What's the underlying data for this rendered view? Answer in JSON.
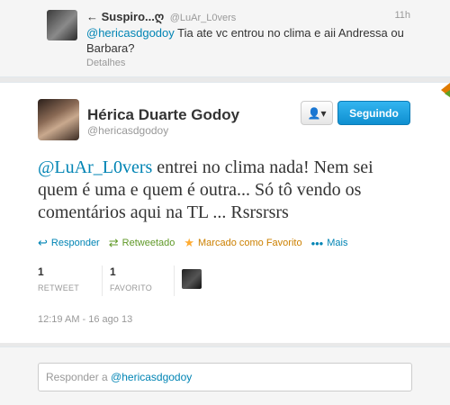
{
  "parent_tweet": {
    "back_arrow": "←",
    "name": "Suspiro...ღ",
    "handle": "@LuAr_L0vers",
    "time": "11h",
    "mention": "@hericasdgodoy",
    "text": " Tia ate vc entrou no clima e aii Andressa ou Barbara?",
    "details_label": "Detalhes"
  },
  "tweet": {
    "name": "Hérica Duarte Godoy",
    "handle": "@hericasdgodoy",
    "user_menu_icon": "user-icon",
    "user_menu_glyph": "👤▾",
    "follow_label": "Seguindo",
    "mention": "@LuAr_L0vers",
    "text": " entrei no clima nada! Nem sei quem é uma e quem é outra... Só tô vendo os comentários aqui na TL ... Rsrsrsrs",
    "actions": {
      "reply_label": "Responder",
      "retweet_label": "Retweetado",
      "favorite_label": "Marcado como Favorito",
      "more_label": "Mais"
    },
    "stats": {
      "retweets": "1",
      "retweets_label": "RETWEET",
      "favorites": "1",
      "favorites_label": "FAVORITO"
    },
    "datetime": "12:19 AM - 16 ago 13"
  },
  "reply": {
    "placeholder_prefix": "Responder a ",
    "placeholder_mention": "@hericasdgodoy"
  },
  "colors": {
    "link": "#0084b4",
    "follow_button": "#1b95e0",
    "retweeted": "#609928",
    "favorited": "#ffac33"
  }
}
